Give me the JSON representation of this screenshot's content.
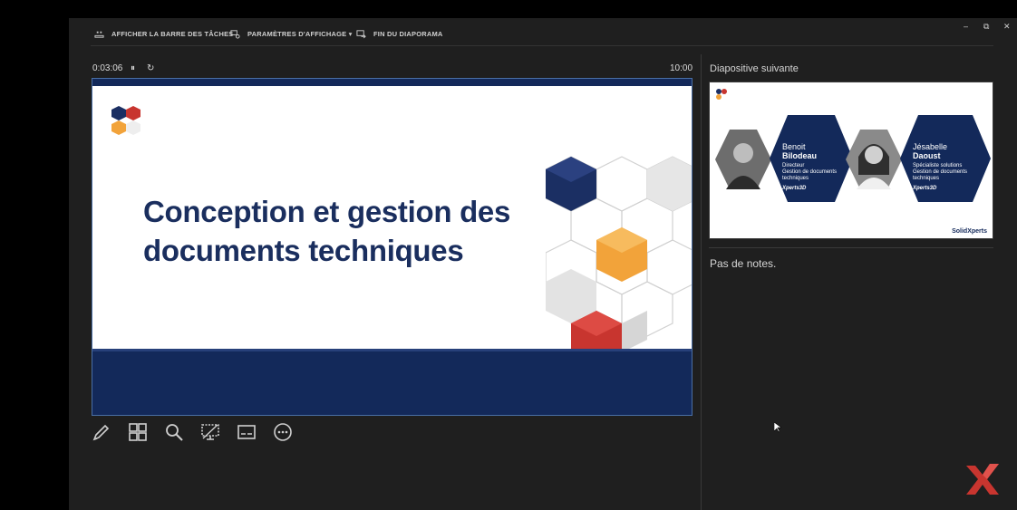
{
  "toolbar": {
    "taskbar_label": "AFFICHER LA BARRE DES TÂCHES",
    "display_settings_label": "PARAMÈTRES D'AFFICHAGE ▾",
    "end_show_label": "FIN DU DIAPORAMA",
    "minimize": "–",
    "restore": "⧉",
    "close": "✕"
  },
  "presenter": {
    "elapsed": "0:03:06",
    "pause_icon": "⏸",
    "restart_icon": "↻",
    "clock": "10:00"
  },
  "current_slide": {
    "title_line1": "Conception et gestion des",
    "title_line2": "documents techniques"
  },
  "next_slide": {
    "label": "Diapositive suivante",
    "person1_first": "Benoit",
    "person1_last": "Bilodeau",
    "person1_role_line1": "Directeur",
    "person1_role_line2": "Gestion de documents",
    "person1_role_line3": "techniques",
    "person2_first": "Jésabelle",
    "person2_last": "Daoust",
    "person2_role_line1": "Spécialiste solutions",
    "person2_role_line2": "Gestion de documents",
    "person2_role_line3": "techniques",
    "badge": "Xperts3D",
    "logo": "SolidXperts"
  },
  "notes": {
    "text": "Pas de notes."
  },
  "colors": {
    "navy": "#13295a",
    "orange": "#f2a33a",
    "red": "#c8352f",
    "accent_blue": "#1b2f63"
  }
}
